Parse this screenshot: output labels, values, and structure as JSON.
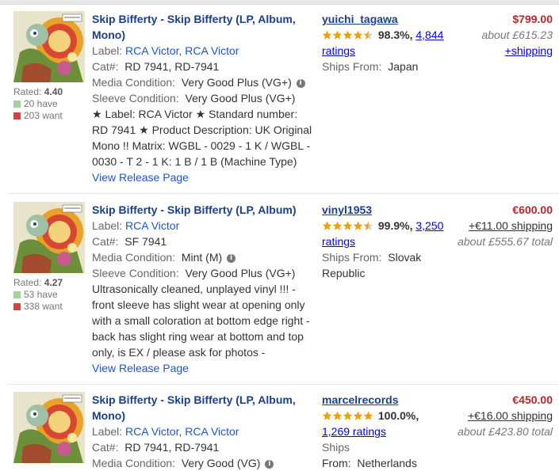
{
  "listings": [
    {
      "rating": "4.40",
      "rated_label": "Rated:",
      "have": "20 have",
      "want": "203 want",
      "title": "Skip Bifferty - Skip Bifferty (LP, Album, Mono)",
      "label_key": "Label:",
      "label_val": "RCA Victor, RCA Victor",
      "cat_key": "Cat#:",
      "cat_val": "RD 7941, RD-7941",
      "media_key": "Media Condition:",
      "media_val": "Very Good Plus (VG+)",
      "sleeve_key": "Sleeve Condition:",
      "sleeve_val": "Very Good Plus (VG+)",
      "comment": "★ Label: RCA Victor ★ Standard number: RD 7941 ★ Product Description: UK Original Mono !! Matrix: WGBL - 0029 - 1 K / WGBL - 0030 - T 2 - 1 K: 1 B / 1 B (Machine Type)",
      "release_link": "View Release Page",
      "seller": "yuichi_tagawa",
      "seller_stars": 4.5,
      "seller_pct": "98.3%,",
      "seller_ratings_count": "4,844",
      "seller_ratings_word": "ratings",
      "ships_from_key": "Ships From:",
      "ships_from_val": "Japan",
      "price": "$799.00",
      "price_line2": "about £615.23",
      "price_line3": "+shipping"
    },
    {
      "rating": "4.27",
      "rated_label": "Rated:",
      "have": "53 have",
      "want": "338 want",
      "title": "Skip Bifferty - Skip Bifferty (LP, Album)",
      "label_key": "Label:",
      "label_val": "RCA Victor",
      "cat_key": "Cat#:",
      "cat_val": "SF 7941",
      "media_key": "Media Condition:",
      "media_val": "Mint (M)",
      "sleeve_key": "Sleeve Condition:",
      "sleeve_val": "Very Good Plus (VG+)",
      "comment": "Ultrasonically cleaned, unplayed vinyl !!! - front sleeve has slight wear at opening only with a small coloration at bottom edge right - back has slight ring wear at bottom and top only, is EX / please ask for photos -",
      "release_link": "View Release Page",
      "seller": "vinyl1953",
      "seller_stars": 4.5,
      "seller_pct": "99.9%,",
      "seller_ratings_count": "3,250",
      "seller_ratings_word": "ratings",
      "ships_from_key": "Ships From:",
      "ships_from_val": "Slovak Republic",
      "price": "€600.00",
      "price_line2": "+€11.00 shipping",
      "price_line3": "about £555.67 total"
    },
    {
      "title": "Skip Bifferty - Skip Bifferty (LP, Album, Mono)",
      "label_key": "Label:",
      "label_val": "RCA Victor, RCA Victor",
      "cat_key": "Cat#:",
      "cat_val": "RD 7941, RD-7941",
      "media_key": "Media Condition:",
      "media_val": "Very Good (VG)",
      "seller": "marcelrecords",
      "seller_stars": 5,
      "seller_pct": "100.0%,",
      "seller_ratings_text": "1,269 ratings",
      "ships_from_key": "Ships",
      "ships_from_val": "From:  Netherlands",
      "price": "€450.00",
      "price_line2": "+€16.00 shipping",
      "price_line3": "about £423.80 total"
    }
  ],
  "colors": {
    "title_blue": "#1b3f8a",
    "link_blue": "#1e56c8",
    "price_red": "#b5292b",
    "star_gold": "#f0a000",
    "have_green": "#a3d39c",
    "want_red": "#d9423c"
  },
  "icons": [
    "album-cover-image",
    "info-icon",
    "star-icon",
    "have-square-icon",
    "want-square-icon"
  ]
}
